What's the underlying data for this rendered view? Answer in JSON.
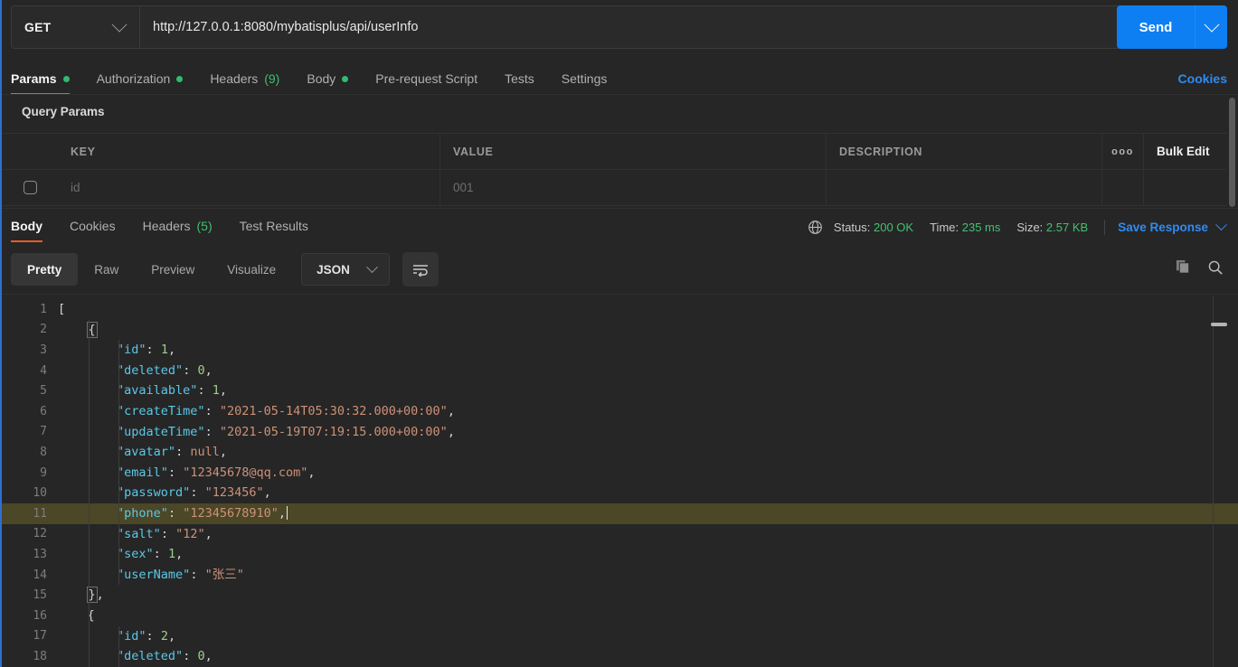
{
  "request": {
    "method": "GET",
    "url": "http://127.0.0.1:8080/mybatisplus/api/userInfo",
    "send_label": "Send",
    "tabs": [
      {
        "label": "Params",
        "badge_dot": true,
        "active": true
      },
      {
        "label": "Authorization",
        "badge_dot": true,
        "active": false
      },
      {
        "label": "Headers",
        "count": "(9)",
        "active": false
      },
      {
        "label": "Body",
        "badge_dot": true,
        "active": false
      },
      {
        "label": "Pre-request Script",
        "active": false
      },
      {
        "label": "Tests",
        "active": false
      },
      {
        "label": "Settings",
        "active": false
      }
    ],
    "cookies_link": "Cookies"
  },
  "query_params": {
    "title": "Query Params",
    "columns": [
      "KEY",
      "VALUE",
      "DESCRIPTION"
    ],
    "options_icon": "ooo",
    "bulk_edit_label": "Bulk Edit",
    "rows": [
      {
        "checked": false,
        "key": "id",
        "value": "001",
        "description": ""
      }
    ]
  },
  "response": {
    "tabs": [
      {
        "label": "Body",
        "active": true
      },
      {
        "label": "Cookies",
        "active": false
      },
      {
        "label": "Headers",
        "count": "(5)",
        "active": false
      },
      {
        "label": "Test Results",
        "active": false
      }
    ],
    "status_label": "Status:",
    "status_value": "200 OK",
    "time_label": "Time:",
    "time_value": "235 ms",
    "size_label": "Size:",
    "size_value": "2.57 KB",
    "save_response_label": "Save Response",
    "view_modes": [
      {
        "label": "Pretty",
        "active": true
      },
      {
        "label": "Raw",
        "active": false
      },
      {
        "label": "Preview",
        "active": false
      },
      {
        "label": "Visualize",
        "active": false
      }
    ],
    "format": "JSON"
  },
  "code": {
    "active_line": 11,
    "lines": [
      {
        "num": 1,
        "tokens": [
          {
            "t": "[",
            "c": "p"
          }
        ]
      },
      {
        "num": 2,
        "tokens": [
          {
            "t": "    ",
            "c": "p"
          },
          {
            "t": "{",
            "c": "box"
          }
        ]
      },
      {
        "num": 3,
        "tokens": [
          {
            "t": "        ",
            "c": "p"
          },
          {
            "t": "\"id\"",
            "c": "k"
          },
          {
            "t": ": ",
            "c": "p"
          },
          {
            "t": "1",
            "c": "n"
          },
          {
            "t": ",",
            "c": "p"
          }
        ]
      },
      {
        "num": 4,
        "tokens": [
          {
            "t": "        ",
            "c": "p"
          },
          {
            "t": "\"deleted\"",
            "c": "k"
          },
          {
            "t": ": ",
            "c": "p"
          },
          {
            "t": "0",
            "c": "n"
          },
          {
            "t": ",",
            "c": "p"
          }
        ]
      },
      {
        "num": 5,
        "tokens": [
          {
            "t": "        ",
            "c": "p"
          },
          {
            "t": "\"available\"",
            "c": "k"
          },
          {
            "t": ": ",
            "c": "p"
          },
          {
            "t": "1",
            "c": "n"
          },
          {
            "t": ",",
            "c": "p"
          }
        ]
      },
      {
        "num": 6,
        "tokens": [
          {
            "t": "        ",
            "c": "p"
          },
          {
            "t": "\"createTime\"",
            "c": "k"
          },
          {
            "t": ": ",
            "c": "p"
          },
          {
            "t": "\"2021-05-14T05:30:32.000+00:00\"",
            "c": "s"
          },
          {
            "t": ",",
            "c": "p"
          }
        ]
      },
      {
        "num": 7,
        "tokens": [
          {
            "t": "        ",
            "c": "p"
          },
          {
            "t": "\"updateTime\"",
            "c": "k"
          },
          {
            "t": ": ",
            "c": "p"
          },
          {
            "t": "\"2021-05-19T07:19:15.000+00:00\"",
            "c": "s"
          },
          {
            "t": ",",
            "c": "p"
          }
        ]
      },
      {
        "num": 8,
        "tokens": [
          {
            "t": "        ",
            "c": "p"
          },
          {
            "t": "\"avatar\"",
            "c": "k"
          },
          {
            "t": ": ",
            "c": "p"
          },
          {
            "t": "null",
            "c": "nl"
          },
          {
            "t": ",",
            "c": "p"
          }
        ]
      },
      {
        "num": 9,
        "tokens": [
          {
            "t": "        ",
            "c": "p"
          },
          {
            "t": "\"email\"",
            "c": "k"
          },
          {
            "t": ": ",
            "c": "p"
          },
          {
            "t": "\"12345678@qq.com\"",
            "c": "s"
          },
          {
            "t": ",",
            "c": "p"
          }
        ]
      },
      {
        "num": 10,
        "tokens": [
          {
            "t": "        ",
            "c": "p"
          },
          {
            "t": "\"password\"",
            "c": "k"
          },
          {
            "t": ": ",
            "c": "p"
          },
          {
            "t": "\"123456\"",
            "c": "s"
          },
          {
            "t": ",",
            "c": "p"
          }
        ]
      },
      {
        "num": 11,
        "tokens": [
          {
            "t": "        ",
            "c": "p"
          },
          {
            "t": "\"phone\"",
            "c": "k"
          },
          {
            "t": ": ",
            "c": "p"
          },
          {
            "t": "\"12345678910\"",
            "c": "s"
          },
          {
            "t": ",",
            "c": "p"
          },
          {
            "t": "|",
            "c": "caret"
          }
        ]
      },
      {
        "num": 12,
        "tokens": [
          {
            "t": "        ",
            "c": "p"
          },
          {
            "t": "\"salt\"",
            "c": "k"
          },
          {
            "t": ": ",
            "c": "p"
          },
          {
            "t": "\"12\"",
            "c": "s"
          },
          {
            "t": ",",
            "c": "p"
          }
        ]
      },
      {
        "num": 13,
        "tokens": [
          {
            "t": "        ",
            "c": "p"
          },
          {
            "t": "\"sex\"",
            "c": "k"
          },
          {
            "t": ": ",
            "c": "p"
          },
          {
            "t": "1",
            "c": "n"
          },
          {
            "t": ",",
            "c": "p"
          }
        ]
      },
      {
        "num": 14,
        "tokens": [
          {
            "t": "        ",
            "c": "p"
          },
          {
            "t": "\"userName\"",
            "c": "k"
          },
          {
            "t": ": ",
            "c": "p"
          },
          {
            "t": "\"张三\"",
            "c": "s"
          }
        ]
      },
      {
        "num": 15,
        "tokens": [
          {
            "t": "    ",
            "c": "p"
          },
          {
            "t": "}",
            "c": "box"
          },
          {
            "t": ",",
            "c": "p"
          }
        ]
      },
      {
        "num": 16,
        "tokens": [
          {
            "t": "    ",
            "c": "p"
          },
          {
            "t": "{",
            "c": "p"
          }
        ]
      },
      {
        "num": 17,
        "tokens": [
          {
            "t": "        ",
            "c": "p"
          },
          {
            "t": "\"id\"",
            "c": "k"
          },
          {
            "t": ": ",
            "c": "p"
          },
          {
            "t": "2",
            "c": "n"
          },
          {
            "t": ",",
            "c": "p"
          }
        ]
      },
      {
        "num": 18,
        "tokens": [
          {
            "t": "        ",
            "c": "p"
          },
          {
            "t": "\"deleted\"",
            "c": "k"
          },
          {
            "t": ": ",
            "c": "p"
          },
          {
            "t": "0",
            "c": "n"
          },
          {
            "t": ",",
            "c": "p"
          }
        ]
      }
    ]
  },
  "icons": {
    "copy": "copy-icon",
    "search": "search-icon",
    "wrap": "word-wrap-icon",
    "globe": "globe-icon"
  },
  "colors": {
    "accent_blue": "#0d7ff2",
    "tab_underline": "#ef5b25",
    "status_green": "#43c172",
    "link_blue": "#2f8bf5"
  }
}
